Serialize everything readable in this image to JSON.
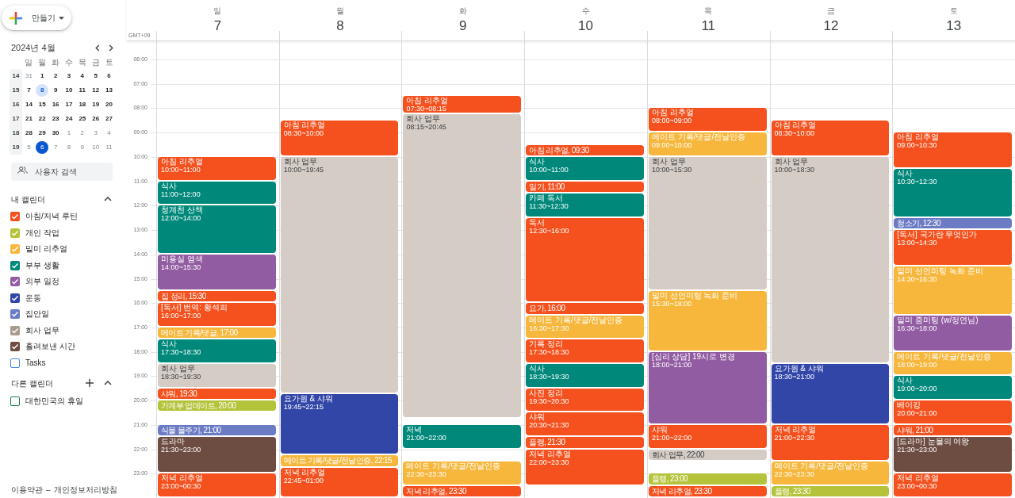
{
  "create_button": {
    "label": "만들기"
  },
  "mini_calendar": {
    "title": "2024년 4월",
    "weekdays": [
      "일",
      "월",
      "화",
      "수",
      "목",
      "금",
      "토"
    ],
    "weeks": [
      {
        "number": "14",
        "days": [
          {
            "day": "31",
            "muted": true,
            "selected": false,
            "today": false
          },
          {
            "day": "1",
            "muted": false,
            "selected": false,
            "today": false
          },
          {
            "day": "2",
            "muted": false,
            "selected": false,
            "today": false
          },
          {
            "day": "3",
            "muted": false,
            "selected": false,
            "today": false
          },
          {
            "day": "4",
            "muted": false,
            "selected": false,
            "today": false
          },
          {
            "day": "5",
            "muted": false,
            "selected": false,
            "today": false
          },
          {
            "day": "6",
            "muted": false,
            "selected": false,
            "today": false
          }
        ]
      },
      {
        "number": "15",
        "days": [
          {
            "day": "7",
            "muted": false,
            "selected": false,
            "today": false
          },
          {
            "day": "8",
            "muted": false,
            "selected": true,
            "today": false
          },
          {
            "day": "9",
            "muted": false,
            "selected": false,
            "today": false
          },
          {
            "day": "10",
            "muted": false,
            "selected": false,
            "today": false
          },
          {
            "day": "11",
            "muted": false,
            "selected": false,
            "today": false
          },
          {
            "day": "12",
            "muted": false,
            "selected": false,
            "today": false
          },
          {
            "day": "13",
            "muted": false,
            "selected": false,
            "today": false
          }
        ]
      },
      {
        "number": "16",
        "days": [
          {
            "day": "14",
            "muted": false,
            "selected": false,
            "today": false
          },
          {
            "day": "15",
            "muted": false,
            "selected": false,
            "today": false
          },
          {
            "day": "16",
            "muted": false,
            "selected": false,
            "today": false
          },
          {
            "day": "17",
            "muted": false,
            "selected": false,
            "today": false
          },
          {
            "day": "18",
            "muted": false,
            "selected": false,
            "today": false
          },
          {
            "day": "19",
            "muted": false,
            "selected": false,
            "today": false
          },
          {
            "day": "20",
            "muted": false,
            "selected": false,
            "today": false
          }
        ]
      },
      {
        "number": "17",
        "days": [
          {
            "day": "21",
            "muted": false,
            "selected": false,
            "today": false
          },
          {
            "day": "22",
            "muted": false,
            "selected": false,
            "today": false
          },
          {
            "day": "23",
            "muted": false,
            "selected": false,
            "today": false
          },
          {
            "day": "24",
            "muted": false,
            "selected": false,
            "today": false
          },
          {
            "day": "25",
            "muted": false,
            "selected": false,
            "today": false
          },
          {
            "day": "26",
            "muted": false,
            "selected": false,
            "today": false
          },
          {
            "day": "27",
            "muted": false,
            "selected": false,
            "today": false
          }
        ]
      },
      {
        "number": "18",
        "days": [
          {
            "day": "28",
            "muted": false,
            "selected": false,
            "today": false
          },
          {
            "day": "29",
            "muted": false,
            "selected": false,
            "today": false
          },
          {
            "day": "30",
            "muted": false,
            "selected": false,
            "today": false
          },
          {
            "day": "1",
            "muted": true,
            "selected": false,
            "today": false
          },
          {
            "day": "2",
            "muted": true,
            "selected": false,
            "today": false
          },
          {
            "day": "3",
            "muted": true,
            "selected": false,
            "today": false
          },
          {
            "day": "4",
            "muted": true,
            "selected": false,
            "today": false
          }
        ]
      },
      {
        "number": "19",
        "days": [
          {
            "day": "5",
            "muted": true,
            "selected": false,
            "today": false
          },
          {
            "day": "6",
            "muted": true,
            "selected": false,
            "today": true
          },
          {
            "day": "7",
            "muted": true,
            "selected": false,
            "today": false
          },
          {
            "day": "8",
            "muted": true,
            "selected": false,
            "today": false
          },
          {
            "day": "9",
            "muted": true,
            "selected": false,
            "today": false
          },
          {
            "day": "10",
            "muted": true,
            "selected": false,
            "today": false
          },
          {
            "day": "11",
            "muted": true,
            "selected": false,
            "today": false
          }
        ]
      }
    ]
  },
  "people_search": {
    "placeholder": "사용자 검색"
  },
  "my_calendars": {
    "title": "내 캘린더",
    "expanded": true,
    "items": [
      {
        "label": "아침/저녁 루틴",
        "color": "#f4511e",
        "checked": true
      },
      {
        "label": "개인 작업",
        "color": "#b5c33a",
        "checked": true
      },
      {
        "label": "밑미 리추얼",
        "color": "#f6b73c",
        "checked": true
      },
      {
        "label": "부부 생활",
        "color": "#00897b",
        "checked": true
      },
      {
        "label": "외부 일정",
        "color": "#925ca2",
        "checked": true
      },
      {
        "label": "운동",
        "color": "#3246a8",
        "checked": true
      },
      {
        "label": "집안일",
        "color": "#6b7bc4",
        "checked": true
      },
      {
        "label": "회사 업무",
        "color": "#a79b8e",
        "checked": true
      },
      {
        "label": "흘려보낸 시간",
        "color": "#6d4c41",
        "checked": true
      },
      {
        "label": "Tasks",
        "color": "#4285f4",
        "checked": false
      }
    ]
  },
  "other_calendars": {
    "title": "다른 캘린더",
    "expanded": true,
    "items": [
      {
        "label": "대한민국의 휴일",
        "color": "#0b8043",
        "checked": false
      }
    ]
  },
  "footer": {
    "links": [
      "이용약관",
      "개인정보처리방침"
    ],
    "separator": "–"
  },
  "timezone": "GMT+09",
  "hour_labels": [
    "06:00",
    "07:00",
    "08:00",
    "09:00",
    "10:00",
    "11:00",
    "12:00",
    "13:00",
    "14:00",
    "15:00",
    "16:00",
    "17:00",
    "18:00",
    "19:00",
    "20:00",
    "21:00",
    "22:00",
    "23:00"
  ],
  "days": [
    {
      "weekday": "일",
      "date": "7",
      "events": [
        {
          "kind": "block",
          "title": "아침 리추얼",
          "time": "10:00~11:00",
          "color": "#f4511e"
        },
        {
          "kind": "block",
          "title": "식사",
          "time": "11:00~12:00",
          "color": "#00897b"
        },
        {
          "kind": "block",
          "title": "청계천 산책",
          "time": "12:00~14:00",
          "color": "#00897b"
        },
        {
          "kind": "block",
          "title": "미용실 염색",
          "time": "14:00~15:30",
          "color": "#925ca2"
        },
        {
          "kind": "short",
          "label": "집 정리, 15:30",
          "color": "#f4511e"
        },
        {
          "kind": "block",
          "title": "[독서] 번역: 황석희",
          "time": "16:00~17:00",
          "color": "#f4511e"
        },
        {
          "kind": "short",
          "label": "메이트 기록/댓글, 17:00",
          "color": "#f6b73c"
        },
        {
          "kind": "block",
          "title": "식사",
          "time": "17:30~18:30",
          "color": "#00897b"
        },
        {
          "kind": "block",
          "title": "회사 업무",
          "time": "18:30~19:30",
          "color": "#d5ccc5"
        },
        {
          "kind": "short",
          "label": "샤워, 19:30",
          "color": "#f4511e"
        },
        {
          "kind": "short",
          "label": "가계부 업데이트, 20:00",
          "color": "#b5c33a"
        },
        {
          "kind": "short",
          "label": "식물 물주기, 21:00",
          "color": "#6b7bc4"
        },
        {
          "kind": "block",
          "title": "드라마",
          "time": "21:30~23:00",
          "color": "#6d4c41"
        },
        {
          "kind": "block",
          "title": "저녁 리추얼",
          "time": "23:00~00:30",
          "color": "#f4511e"
        }
      ]
    },
    {
      "weekday": "월",
      "date": "8",
      "events": [
        {
          "kind": "block",
          "title": "아침 리추얼",
          "time": "08:30~10:00",
          "color": "#f4511e"
        },
        {
          "kind": "block",
          "title": "회사 업무",
          "time": "10:00~19:45",
          "color": "#d5ccc5"
        },
        {
          "kind": "block",
          "title": "요가원 & 샤워",
          "time": "19:45~22:15",
          "color": "#3246a8"
        },
        {
          "kind": "short",
          "label": "메이트 기록/댓글/전날인증, 22:15",
          "color": "#f6b73c"
        },
        {
          "kind": "block",
          "title": "저녁 리추얼",
          "time": "22:45~01:00",
          "color": "#f4511e"
        }
      ]
    },
    {
      "weekday": "화",
      "date": "9",
      "events": [
        {
          "kind": "block",
          "title": "아침 리추얼",
          "time": "07:30~08:15",
          "color": "#f4511e"
        },
        {
          "kind": "block",
          "title": "회사 업무",
          "time": "08:15~20:45",
          "color": "#d5ccc5"
        },
        {
          "kind": "block",
          "title": "저녁",
          "time": "21:00~22:00",
          "color": "#00897b"
        },
        {
          "kind": "block",
          "title": "메이트 기록/댓글/전날인증",
          "time": "22:30~23:30",
          "color": "#f6b73c"
        },
        {
          "kind": "short",
          "label": "저녁 리추얼, 23:30",
          "color": "#f4511e"
        }
      ]
    },
    {
      "weekday": "수",
      "date": "10",
      "events": [
        {
          "kind": "short",
          "label": "아침 리추얼, 09:30",
          "color": "#f4511e"
        },
        {
          "kind": "block",
          "title": "식사",
          "time": "10:00~11:00",
          "color": "#00897b"
        },
        {
          "kind": "short",
          "label": "일기, 11:00",
          "color": "#f4511e"
        },
        {
          "kind": "block",
          "title": "카페 독서",
          "time": "11:30~12:30",
          "color": "#00897b"
        },
        {
          "kind": "block",
          "title": "독서",
          "time": "12:30~16:00",
          "color": "#f4511e"
        },
        {
          "kind": "short",
          "label": "요가, 16:00",
          "color": "#f4511e"
        },
        {
          "kind": "block",
          "title": "메이트 기록/댓글/전날인증",
          "time": "16:30~17:30",
          "color": "#f6b73c"
        },
        {
          "kind": "block",
          "title": "기록 정리",
          "time": "17:30~18:30",
          "color": "#f4511e"
        },
        {
          "kind": "block",
          "title": "식사",
          "time": "18:30~19:30",
          "color": "#00897b"
        },
        {
          "kind": "block",
          "title": "사진 정리",
          "time": "19:30~20:30",
          "color": "#f4511e"
        },
        {
          "kind": "block",
          "title": "샤워",
          "time": "20:30~21:30",
          "color": "#f4511e"
        },
        {
          "kind": "short",
          "label": "플랭, 21:30",
          "color": "#f4511e"
        },
        {
          "kind": "block",
          "title": "저녁 리추얼",
          "time": "22:00~23:30",
          "color": "#f4511e"
        }
      ]
    },
    {
      "weekday": "목",
      "date": "11",
      "events": [
        {
          "kind": "block",
          "title": "아침 리추얼",
          "time": "08:00~09:00",
          "color": "#f4511e"
        },
        {
          "kind": "block",
          "title": "메이트 기록/댓글/전날인증",
          "time": "09:00~10:00",
          "color": "#f6b73c"
        },
        {
          "kind": "block",
          "title": "회사 업무",
          "time": "10:00~15:30",
          "color": "#d5ccc5"
        },
        {
          "kind": "block",
          "title": "밑미 선언미팅 녹화 준비",
          "time": "15:30~18:00",
          "color": "#f6b73c"
        },
        {
          "kind": "block",
          "title": "[심리 상담] 19시로 변경",
          "time": "18:00~21:00",
          "color": "#925ca2"
        },
        {
          "kind": "block",
          "title": "샤워",
          "time": "21:00~22:00",
          "color": "#f4511e"
        },
        {
          "kind": "short",
          "label": "회사 업무, 22:00",
          "color": "#d5ccc5"
        },
        {
          "kind": "short",
          "label": "플랭, 23:00",
          "color": "#b5c33a"
        },
        {
          "kind": "short",
          "label": "저녁 리추얼, 23:30",
          "color": "#f4511e"
        }
      ]
    },
    {
      "weekday": "금",
      "date": "12",
      "events": [
        {
          "kind": "block",
          "title": "아침 리추얼",
          "time": "08:30~10:00",
          "color": "#f4511e"
        },
        {
          "kind": "block",
          "title": "회사 업무",
          "time": "10:00~18:30",
          "color": "#d5ccc5"
        },
        {
          "kind": "block",
          "title": "요가원 & 샤워",
          "time": "18:30~21:00",
          "color": "#3246a8"
        },
        {
          "kind": "block",
          "title": "저녁 리추얼",
          "time": "21:00~22:30",
          "color": "#f4511e"
        },
        {
          "kind": "block",
          "title": "메이트 기록/댓글/전날인증",
          "time": "22:30~23:30",
          "color": "#f6b73c"
        },
        {
          "kind": "short",
          "label": "플랭, 23:30",
          "color": "#b5c33a"
        }
      ]
    },
    {
      "weekday": "토",
      "date": "13",
      "events": [
        {
          "kind": "block",
          "title": "아침 리추얼",
          "time": "09:00~10:30",
          "color": "#f4511e"
        },
        {
          "kind": "block",
          "title": "식사",
          "time": "10:30~12:30",
          "color": "#00897b"
        },
        {
          "kind": "short",
          "label": "청소기, 12:30",
          "color": "#6b7bc4"
        },
        {
          "kind": "block",
          "title": "[독서] 국가란 무엇인가",
          "time": "13:00~14:30",
          "color": "#f4511e"
        },
        {
          "kind": "block",
          "title": "밑미 선언미팅 녹화 준비",
          "time": "14:30~16:30",
          "color": "#f6b73c"
        },
        {
          "kind": "block",
          "title": "밑미 줌미팅 (w/정연님)",
          "time": "16:30~18:00",
          "color": "#925ca2"
        },
        {
          "kind": "block",
          "title": "메이트 기록/댓글/전날인증",
          "time": "18:00~19:00",
          "color": "#f6b73c"
        },
        {
          "kind": "block",
          "title": "식사",
          "time": "19:00~20:00",
          "color": "#00897b"
        },
        {
          "kind": "block",
          "title": "베이킹",
          "time": "20:00~21:00",
          "color": "#f4511e"
        },
        {
          "kind": "short",
          "label": "샤워, 21:00",
          "color": "#f4511e"
        },
        {
          "kind": "block",
          "title": "[드라마] 눈물의 여왕",
          "time": "21:30~23:00",
          "color": "#6d4c41"
        },
        {
          "kind": "block",
          "title": "저녁 리추얼",
          "time": "23:00~00:30",
          "color": "#f4511e"
        }
      ]
    }
  ]
}
